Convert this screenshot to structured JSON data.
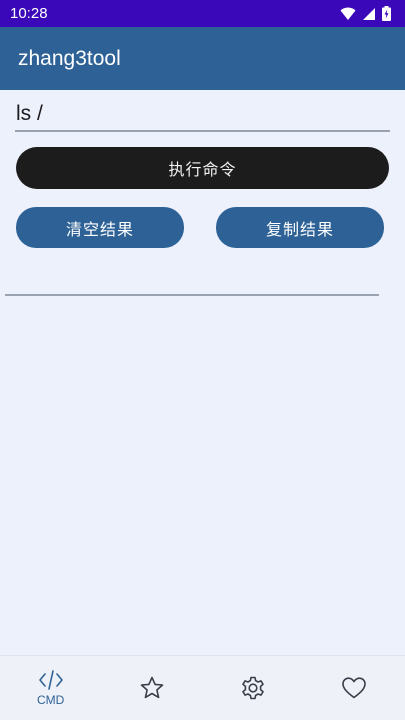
{
  "status_bar": {
    "time": "10:28",
    "icons": [
      "wifi-icon",
      "signal-icon",
      "battery-icon"
    ]
  },
  "app_bar": {
    "title": "zhang3tool"
  },
  "command": {
    "value": "ls /",
    "placeholder": ""
  },
  "buttons": {
    "execute_label": "执行命令",
    "clear_label": "清空结果",
    "copy_label": "复制结果"
  },
  "bottom_nav": {
    "items": [
      {
        "label": "CMD",
        "icon": "code-icon",
        "selected": true
      },
      {
        "label": "",
        "icon": "star-icon"
      },
      {
        "label": "",
        "icon": "settings-icon"
      },
      {
        "label": "",
        "icon": "heart-icon"
      }
    ]
  },
  "colors": {
    "status_bar": "#3a08b8",
    "primary": "#2e6296",
    "execute_button": "#1c1c1c",
    "background": "#edf1fb"
  }
}
